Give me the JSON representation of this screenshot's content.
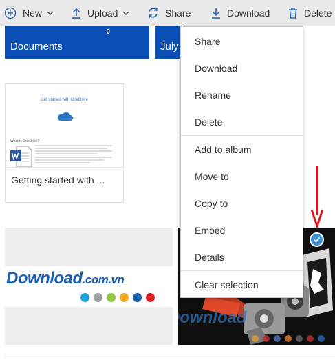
{
  "toolbar": {
    "new_label": "New",
    "upload_label": "Upload",
    "share_label": "Share",
    "download_label": "Download",
    "delete_label": "Delete"
  },
  "folders": [
    {
      "name": "Documents",
      "count": "0"
    },
    {
      "name": "July"
    }
  ],
  "document": {
    "name": "Getting started with ...",
    "thumb_title": "Get started with OneDrive",
    "thumb_subtitle": "What is OneDrive?"
  },
  "photos": {
    "watermark_main": "Download",
    "watermark_domain": ".com.vn",
    "dot_colors": [
      "#1ea0e0",
      "#a0a0a0",
      "#8cc63f",
      "#f5a623",
      "#1a5fb0",
      "#e02020"
    ],
    "right_watermark": "Download"
  },
  "context_menu": {
    "groups": [
      [
        "Share",
        "Download",
        "Rename",
        "Delete"
      ],
      [
        "Add to album",
        "Move to",
        "Copy to",
        "Embed",
        "Details"
      ],
      [
        "Clear selection"
      ]
    ]
  },
  "colors": {
    "folder_blue": "#0a4fb5",
    "accent": "#1a5fb0",
    "arrow_red": "#e0141e",
    "check_blue": "#3b8fd8"
  }
}
